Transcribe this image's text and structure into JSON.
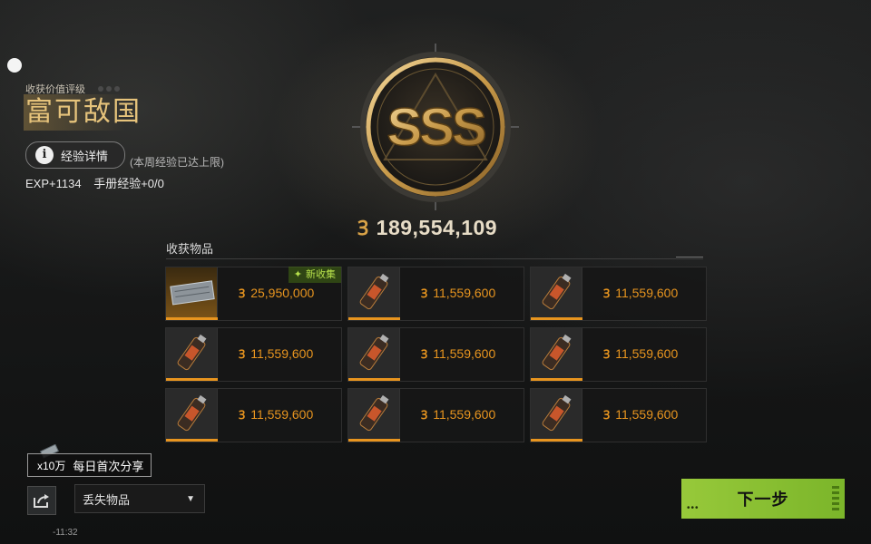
{
  "rating": {
    "label": "收获价值评级",
    "title": "富可敌国",
    "grade": "SSS"
  },
  "exp": {
    "details_button": "经验详情",
    "weekly_limit_note": "(本周经验已达上限)",
    "exp_gain": "EXP+1134",
    "manual_exp": "手册经验+0/0"
  },
  "total_value": "189,554,109",
  "items": {
    "title": "收获物品",
    "new_badge": "新收集",
    "cards": [
      {
        "price": "25,950,000",
        "icon": "bullet-box-icon",
        "rare": true,
        "new": true
      },
      {
        "price": "11,559,600",
        "icon": "spray-can-icon",
        "rare": false,
        "new": false
      },
      {
        "price": "11,559,600",
        "icon": "spray-can-icon",
        "rare": false,
        "new": false
      },
      {
        "price": "11,559,600",
        "icon": "spray-can-icon",
        "rare": false,
        "new": false
      },
      {
        "price": "11,559,600",
        "icon": "spray-can-icon",
        "rare": false,
        "new": false
      },
      {
        "price": "11,559,600",
        "icon": "spray-can-icon",
        "rare": false,
        "new": false
      },
      {
        "price": "11,559,600",
        "icon": "spray-can-icon",
        "rare": false,
        "new": false
      },
      {
        "price": "11,559,600",
        "icon": "spray-can-icon",
        "rare": false,
        "new": false
      },
      {
        "price": "11,559,600",
        "icon": "spray-can-icon",
        "rare": false,
        "new": false
      }
    ]
  },
  "share": {
    "count": "x10万",
    "label": "每日首次分享"
  },
  "lost_items": {
    "selected": "丢失物品"
  },
  "time": "-11:32",
  "next_button": "下一步",
  "colors": {
    "accent": "#e8951f",
    "gold": "#e6c37b",
    "next_green": "#8cc034"
  }
}
